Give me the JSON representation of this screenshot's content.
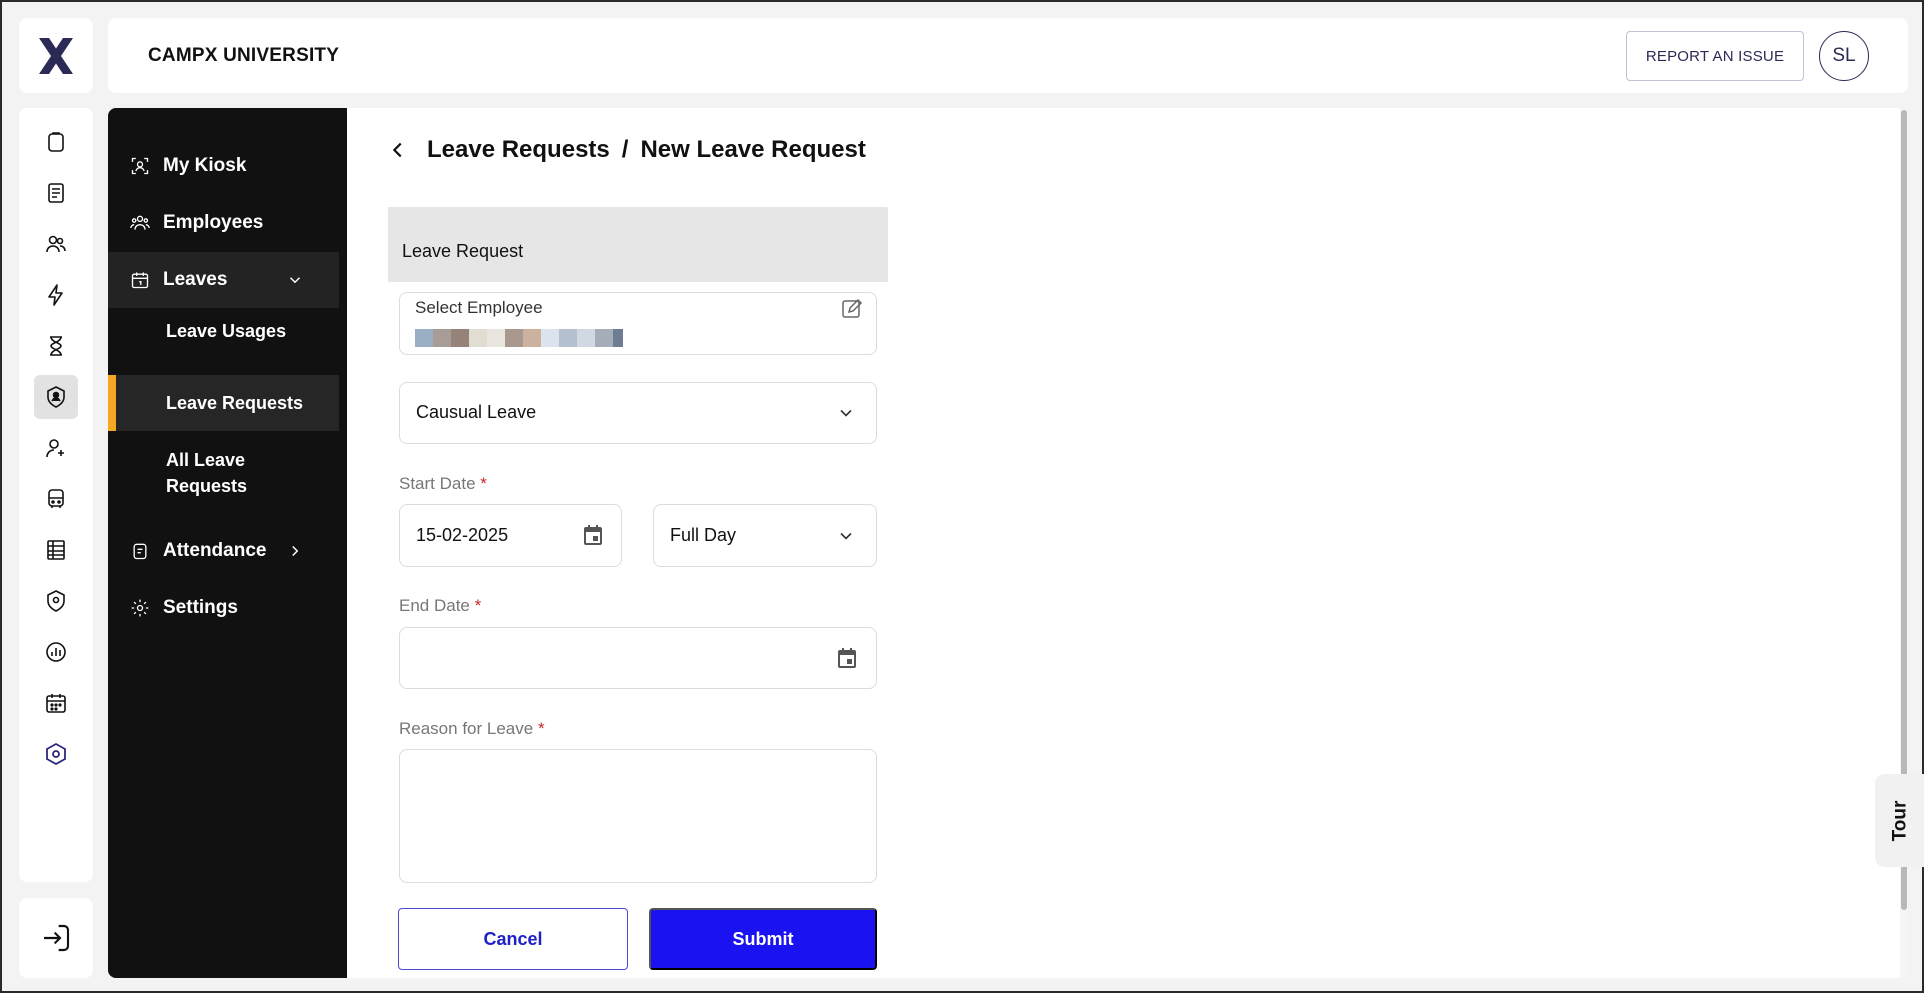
{
  "header": {
    "university_name": "CAMPX UNIVERSITY",
    "report_issue_label": "REPORT AN ISSUE",
    "avatar_initials": "SL"
  },
  "rail": {
    "icons": [
      "clipboard-icon",
      "document-icon",
      "users-icon",
      "lightning-icon",
      "hourglass-icon",
      "badge-user-icon",
      "user-add-icon",
      "bus-icon",
      "ledger-icon",
      "location-shield-icon",
      "stats-icon",
      "calendar-icon",
      "hexagon-settings-icon"
    ],
    "active_index": 5,
    "bottom_icon": "logout-icon"
  },
  "sidenav": {
    "items": [
      {
        "label": "My Kiosk",
        "icon": "kiosk-icon"
      },
      {
        "label": "Employees",
        "icon": "employees-icon"
      },
      {
        "label": "Leaves",
        "icon": "calendar-icon",
        "expanded": true
      },
      {
        "label": "Attendance",
        "icon": "attendance-icon"
      },
      {
        "label": "Settings",
        "icon": "gear-icon"
      }
    ],
    "leaves_sub": [
      {
        "label": "Leave Usages"
      },
      {
        "label": "Leave Requests",
        "active": true
      },
      {
        "label_line1": "All Leave",
        "label_line2": "Requests"
      }
    ],
    "accent_color": "#f5a623"
  },
  "breadcrumb": {
    "parent": "Leave Requests",
    "separator": "/",
    "current": "New Leave Request"
  },
  "form": {
    "title": "Leave Request",
    "select_employee_label": "Select Employee",
    "leave_type_value": "Causual Leave",
    "start_date_label": "Start Date",
    "start_date_value": "15-02-2025",
    "day_type_value": "Full Day",
    "end_date_label": "End Date",
    "end_date_value": "",
    "reason_label": "Reason for Leave",
    "reason_value": "",
    "required_marker": "*",
    "cancel_label": "Cancel",
    "submit_label": "Submit",
    "submit_color": "#1a12f0"
  },
  "tour_label": "Tour"
}
